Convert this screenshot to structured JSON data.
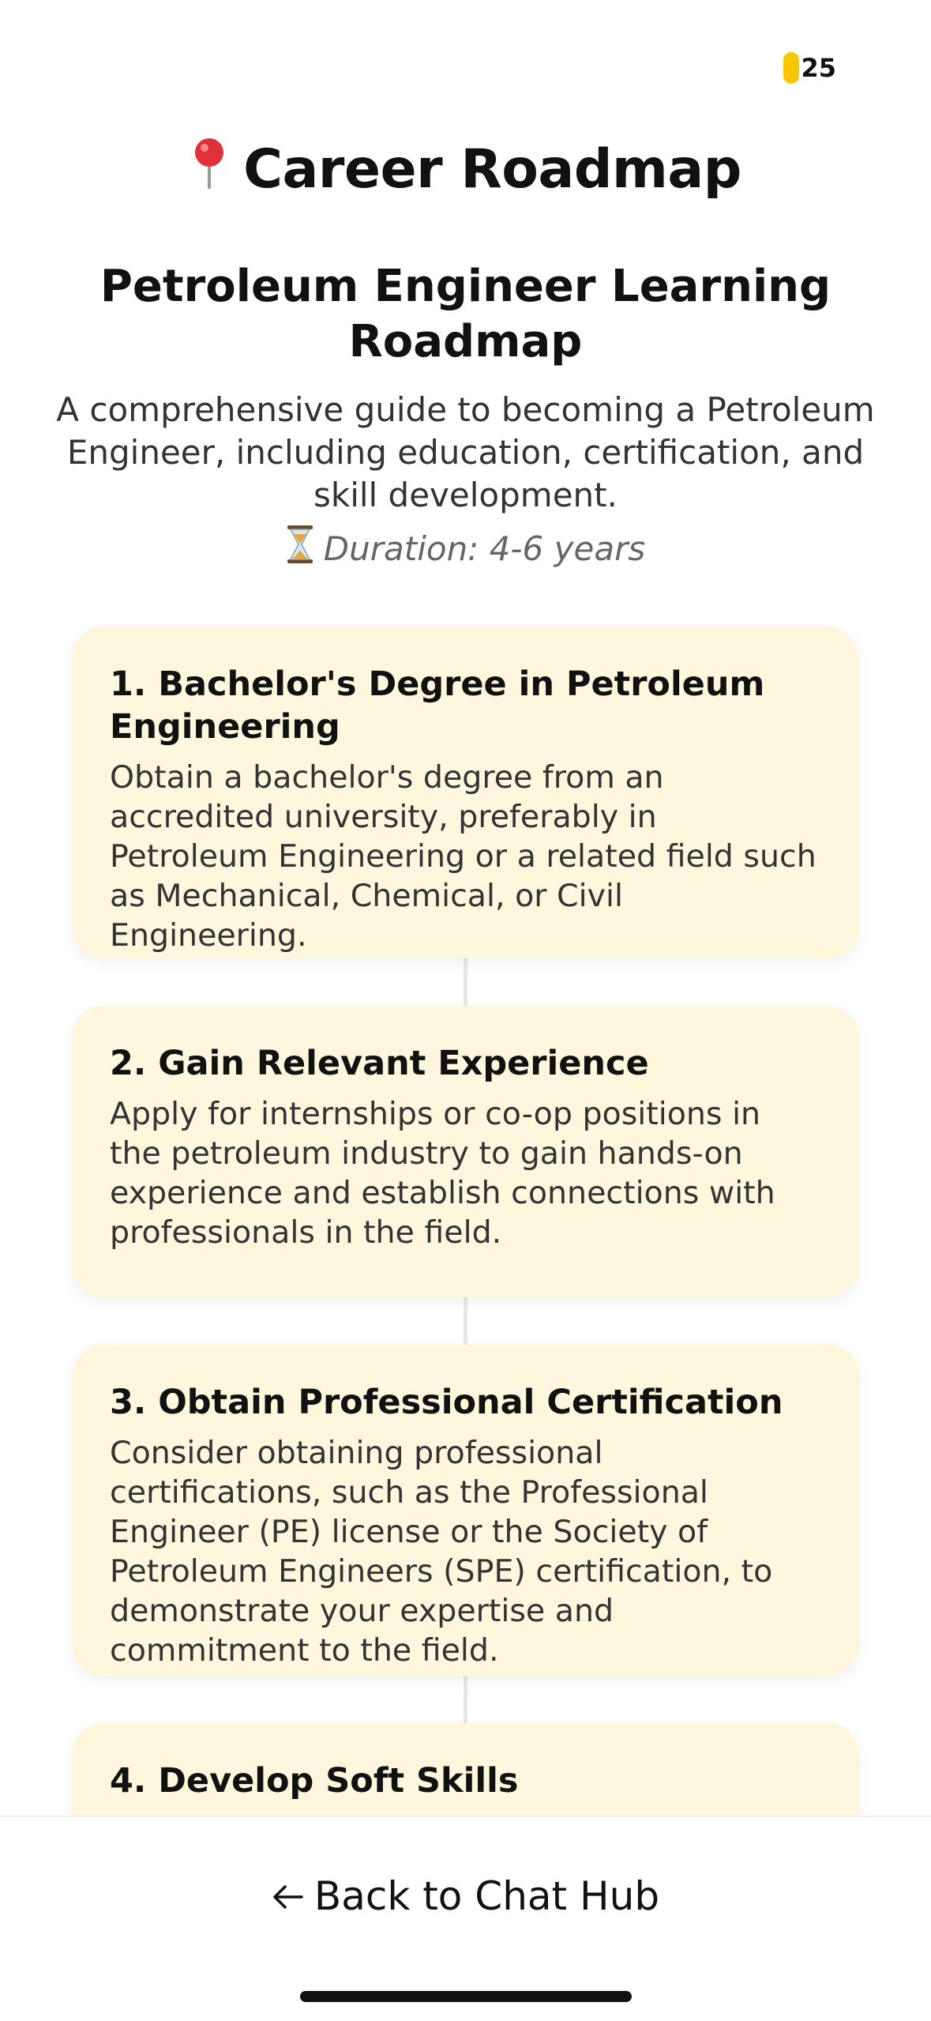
{
  "status": {
    "coins": "25",
    "coin_color": "#f7c600"
  },
  "header": {
    "title": "Career Roadmap",
    "title_icon": "pin-icon"
  },
  "roadmap": {
    "title": "Petroleum Engineer Learning Roadmap",
    "description": "A comprehensive guide to becoming a Petroleum Engineer, including education, certification, and skill development.",
    "duration": "Duration: 4-6 years",
    "duration_icon": "hourglass-icon"
  },
  "steps": [
    {
      "title": "1. Bachelor's Degree in Petroleum Engineering",
      "body": "Obtain a bachelor's degree from an accredited university, preferably in Petroleum Engineering or a related field such as Mechanical, Chemical, or Civil Engineering."
    },
    {
      "title": "2. Gain Relevant Experience",
      "body": "Apply for internships or co-op positions in the petroleum industry to gain hands-on experience and establish connections with professionals in the field."
    },
    {
      "title": "3. Obtain Professional Certification",
      "body": "Consider obtaining professional certifications, such as the Professional Engineer (PE) license or the Society of Petroleum Engineers (SPE) certification, to demonstrate your expertise and commitment to the field."
    },
    {
      "title": "4. Develop Soft Skills",
      "body": ""
    }
  ],
  "footer": {
    "back_label": "Back to Chat Hub",
    "back_icon": "arrow-left-icon"
  },
  "colors": {
    "card_background": "#fef7dd",
    "connector": "#e6e6e6",
    "text_primary": "#111111"
  }
}
